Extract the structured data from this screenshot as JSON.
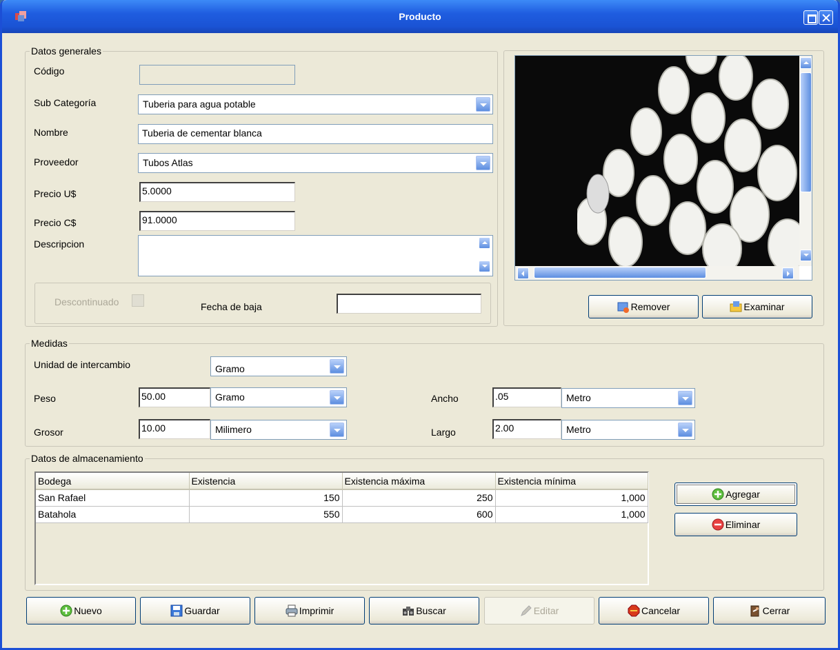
{
  "window": {
    "title": "Producto"
  },
  "general": {
    "legend": "Datos generales",
    "codigo_label": "Código",
    "codigo_value": "",
    "subcat_label": "Sub Categoría",
    "subcat_value": "Tuberia para agua potable",
    "nombre_label": "Nombre",
    "nombre_value": "Tuberia de cementar blanca",
    "proveedor_label": "Proveedor",
    "proveedor_value": "Tubos Atlas",
    "precio_usd_label": "Precio U$",
    "precio_usd_value": "5.0000",
    "precio_cs_label": "Precio C$",
    "precio_cs_value": "91.0000",
    "descripcion_label": "Descripcion",
    "descripcion_value": "",
    "descontinuado_label": "Descontinuado",
    "fecha_baja_label": "Fecha de baja",
    "fecha_baja_value": ""
  },
  "image_panel": {
    "remove_label": "Remover",
    "browse_label": "Examinar"
  },
  "medidas": {
    "legend": "Medidas",
    "unidad_label": "Unidad de intercambio",
    "unidad_value": "Gramo",
    "peso_label": "Peso",
    "peso_value": "50.00",
    "peso_unit": "Gramo",
    "grosor_label": "Grosor",
    "grosor_value": "10.00",
    "grosor_unit": "Milimero",
    "ancho_label": "Ancho",
    "ancho_value": ".05",
    "ancho_unit": "Metro",
    "largo_label": "Largo",
    "largo_value": "2.00",
    "largo_unit": "Metro"
  },
  "storage": {
    "legend": "Datos de almacenamiento",
    "columns": [
      "Bodega",
      "Existencia",
      "Existencia máxima",
      "Existencia mínima"
    ],
    "rows": [
      [
        "San Rafael",
        "150",
        "250",
        "1,000"
      ],
      [
        "Batahola",
        "550",
        "600",
        "1,000"
      ]
    ],
    "add_label": "Agregar",
    "delete_label": "Eliminar"
  },
  "toolbar": {
    "nuevo": "Nuevo",
    "guardar": "Guardar",
    "imprimir": "Imprimir",
    "buscar": "Buscar",
    "editar": "Editar",
    "cancelar": "Cancelar",
    "cerrar": "Cerrar"
  },
  "colors": {
    "title_bar": "#1f5de0",
    "window_bg": "#ece9d8",
    "accent_border": "#003c74"
  }
}
